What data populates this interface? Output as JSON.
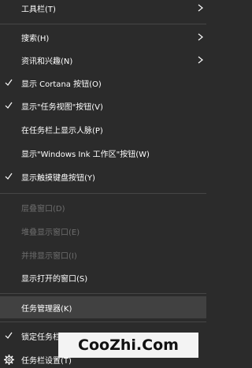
{
  "menu": {
    "items": [
      {
        "label": "工具栏(T)",
        "submenu": true
      },
      {
        "label": "搜索(H)",
        "submenu": true
      },
      {
        "label": "资讯和兴趣(N)",
        "submenu": true
      },
      {
        "label": "显示 Cortana 按钮(O)",
        "checked": true
      },
      {
        "label": "显示\"任务视图\"按钮(V)",
        "checked": true
      },
      {
        "label": "在任务栏上显示人脉(P)"
      },
      {
        "label": "显示\"Windows Ink 工作区\"按钮(W)"
      },
      {
        "label": "显示触摸键盘按钮(Y)",
        "checked": true
      },
      {
        "label": "层叠窗口(D)",
        "disabled": true
      },
      {
        "label": "堆叠显示窗口(E)",
        "disabled": true
      },
      {
        "label": "并排显示窗口(I)",
        "disabled": true
      },
      {
        "label": "显示打开的窗口(S)"
      },
      {
        "label": "任务管理器(K)",
        "highlighted": true
      },
      {
        "label": "锁定任务栏(L)",
        "checked": true
      },
      {
        "label": "任务栏设置(T)",
        "icon": "gear-icon"
      }
    ]
  },
  "watermark": {
    "text": "CooZhi.Com"
  },
  "colors": {
    "background": "#2b2b2b",
    "text": "#ffffff",
    "disabled_text": "#6e6e6e",
    "separator": "#464646",
    "highlight": "#414141"
  }
}
